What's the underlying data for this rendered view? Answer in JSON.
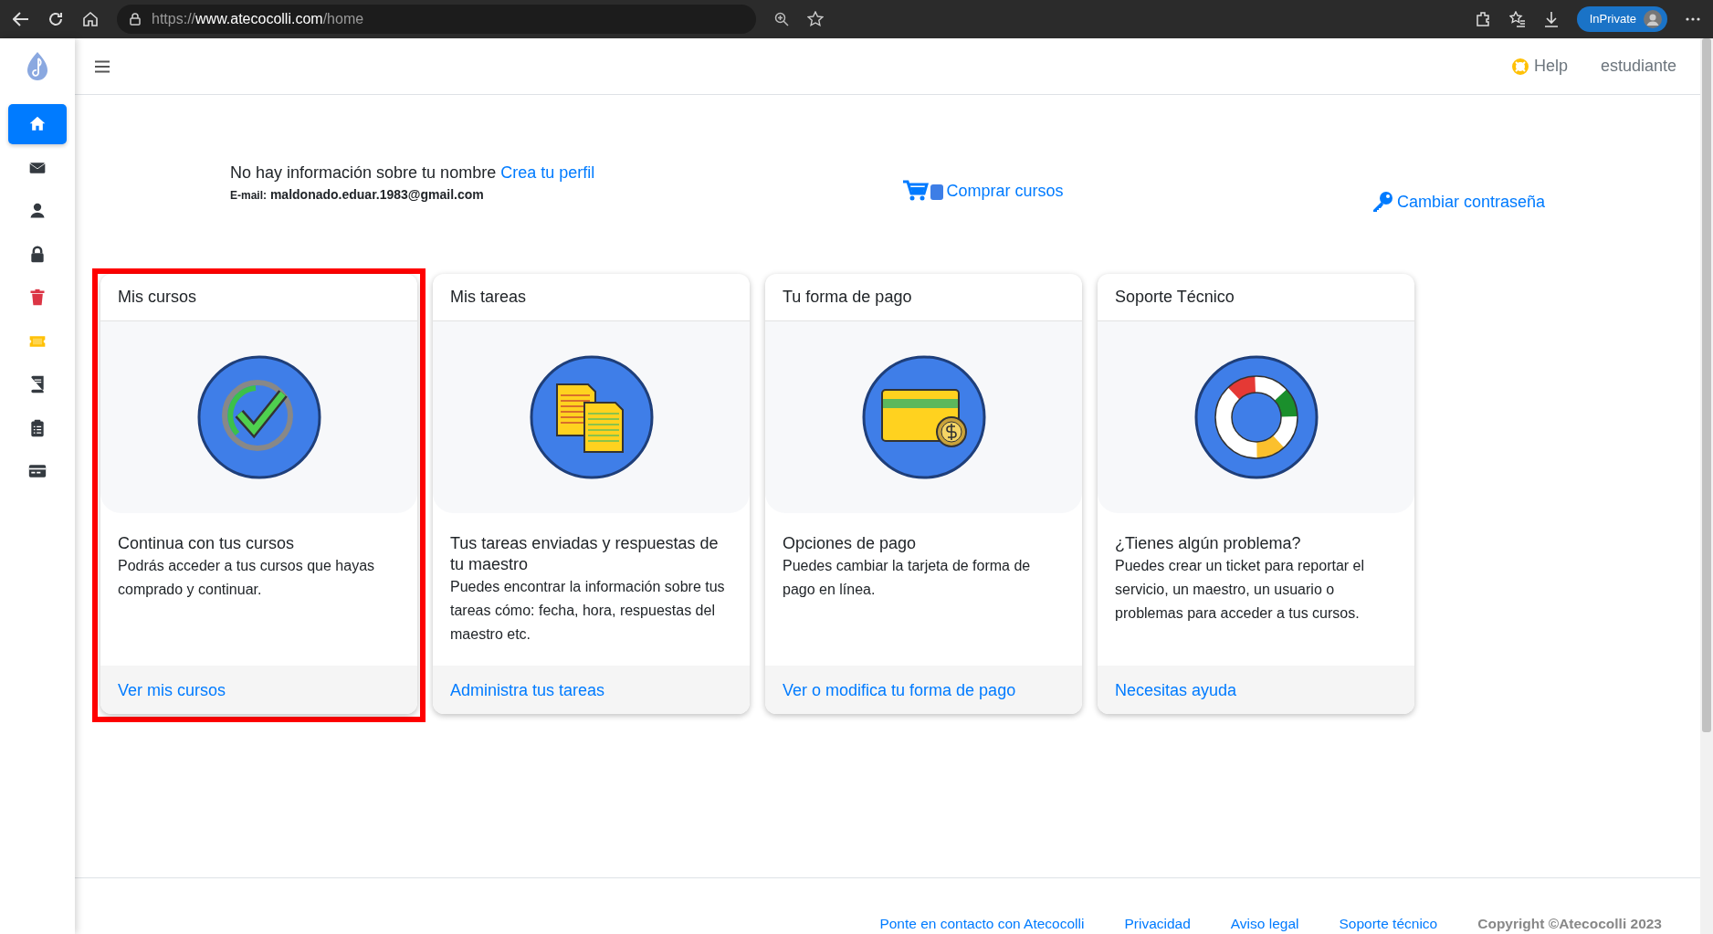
{
  "browser": {
    "url": {
      "scheme": "https://",
      "host": "www.atecocolli.com",
      "path": "/home"
    },
    "private_label": "InPrivate"
  },
  "sidebar": {
    "items": [
      {
        "kind": "home",
        "selected": true,
        "color": "#ffffff"
      },
      {
        "kind": "envelope",
        "selected": false,
        "color": "#343a40"
      },
      {
        "kind": "user",
        "selected": false,
        "color": "#343a40"
      },
      {
        "kind": "lock",
        "selected": false,
        "color": "#343a40"
      },
      {
        "kind": "trash",
        "selected": false,
        "color": "#dc3545"
      },
      {
        "kind": "ticket",
        "selected": false,
        "color": "#ffc107"
      },
      {
        "kind": "book",
        "selected": false,
        "color": "#343a40"
      },
      {
        "kind": "clipboard",
        "selected": false,
        "color": "#343a40"
      },
      {
        "kind": "card",
        "selected": false,
        "color": "#343a40"
      }
    ]
  },
  "topbar": {
    "help": "Help",
    "user": "estudiante"
  },
  "profile": {
    "message": "No hay información sobre tu nombre",
    "create_link": "Crea tu perfil",
    "email_label": "E-mail:",
    "email": "maldonado.eduar.1983@gmail.com",
    "buy_link": "Comprar cursos",
    "password_link": "Cambiar contraseña"
  },
  "cards": [
    {
      "title": "Mis cursos",
      "kind": "check",
      "heading": "Continua con tus cursos",
      "text": "Podrás acceder a tus cursos que hayas comprado y continuar.",
      "link": "Ver mis cursos",
      "highlighted": true
    },
    {
      "title": "Mis tareas",
      "kind": "documents",
      "heading": "Tus tareas enviadas y respuestas de tu maestro",
      "text": "Puedes encontrar la información sobre tus tareas cómo: fecha, hora, respuestas del maestro etc.",
      "link": "Administra tus tareas",
      "highlighted": false
    },
    {
      "title": "Tu forma de pago",
      "kind": "payment",
      "heading": "Opciones de pago",
      "text": "Puedes cambiar la tarjeta de forma de pago en línea.",
      "link": "Ver o modifica tu forma de pago",
      "highlighted": false
    },
    {
      "title": "Soporte Técnico",
      "kind": "lifebuoy",
      "heading": "¿Tienes algún problema?",
      "text": "Puedes crear un ticket para reportar el servicio, un maestro, un usuario o problemas para acceder a tus cursos.",
      "link": "Necesitas ayuda",
      "highlighted": false
    }
  ],
  "footer": {
    "links": [
      "Ponte en contacto con Atecocolli",
      "Privacidad",
      "Aviso legal",
      "Soporte técnico"
    ],
    "copyright": "Copyright ©Atecocolli 2023"
  }
}
